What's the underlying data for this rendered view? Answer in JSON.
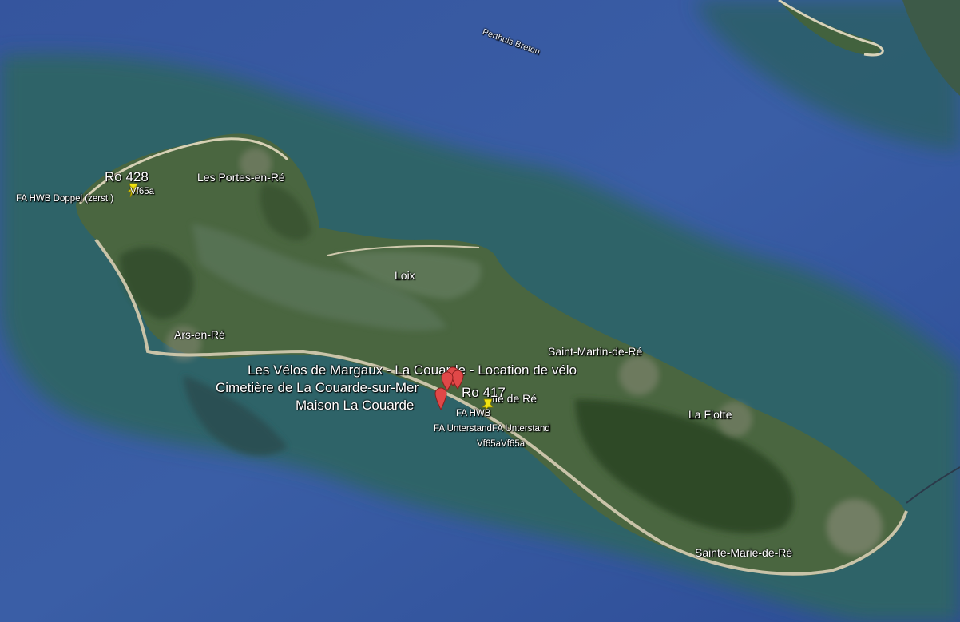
{
  "map": {
    "water_label": "Perthuis Breton",
    "places": {
      "portes": "Les Portes-en-Ré",
      "loix": "Loix",
      "ars": "Ars-en-Ré",
      "saint_martin": "Saint-Martin-de-Ré",
      "la_flotte": "La Flotte",
      "sainte_marie": "Sainte-Marie-de-Ré",
      "ile_de_re": "Ile de Ré"
    },
    "pois": {
      "velos": "Les Vélos de Margaux - La Couarde - Location de vélo",
      "cimetiere": "Cimetière de La Couarde-sur-Mer",
      "maison": "Maison La Couarde"
    },
    "bunkers": {
      "ro428": "Ro 428",
      "ro428_sub1": "Vf65a",
      "ro428_sub2": "FA HWB Doppel (zerst.)",
      "ro417": "Ro 417",
      "ro417_sub1": "FA HWB",
      "ro417_sub2": "FA UnterstandFA Unterstand",
      "ro417_sub3": "Vf65aVf65a"
    },
    "colors": {
      "deep_water": "#33509a",
      "shallow_water": "#2f6a6a",
      "land": "#4c6a3e",
      "beach": "#c9c3a8",
      "pin_red": "#e04848",
      "pin_yellow": "#f2e410"
    }
  }
}
